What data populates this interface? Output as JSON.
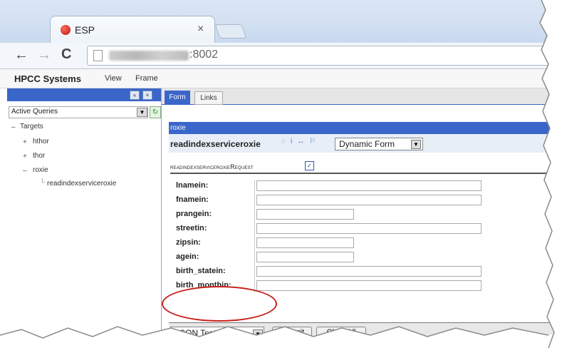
{
  "browser": {
    "tab_title": "ESP",
    "tab_close": "×",
    "back": "←",
    "forward": "→",
    "reload": "C",
    "url_port": ":8002"
  },
  "app": {
    "name": "HPCC Systems",
    "menu": [
      "View",
      "Frame"
    ]
  },
  "left_panel": {
    "header_buttons": [
      "«",
      "×"
    ],
    "query_select": "Active Queries",
    "tree": [
      {
        "toggle": "–",
        "label": "Targets"
      },
      {
        "toggle": "+",
        "label": "hthor"
      },
      {
        "toggle": "+",
        "label": "thor"
      },
      {
        "toggle": "–",
        "label": "roxie"
      },
      {
        "toggle": "",
        "label": "readindexserviceroxie"
      }
    ]
  },
  "right_panel": {
    "tabs": [
      "Form",
      "Links"
    ],
    "section_title": "roxie",
    "service_name": "readindexserviceroxie",
    "form_type": "Dynamic Form",
    "request_label": "readindexserviceroxieRequest",
    "request_checked": "✓",
    "fields": [
      {
        "label": "lnamein:",
        "wide": true
      },
      {
        "label": "fnamein:",
        "wide": true
      },
      {
        "label": "prangein:",
        "wide": false
      },
      {
        "label": "streetin:",
        "wide": true
      },
      {
        "label": "zipsin:",
        "wide": false
      },
      {
        "label": "agein:",
        "wide": false
      },
      {
        "label": "birth_statein:",
        "wide": true
      },
      {
        "label": "birth_monthin:",
        "wide": true
      }
    ],
    "test_type": "JSON Test",
    "submit": "Submit",
    "clear_all": "Clear All"
  },
  "colors": {
    "header_blue": "#3a66c9",
    "annotation_red": "#c8201a"
  }
}
